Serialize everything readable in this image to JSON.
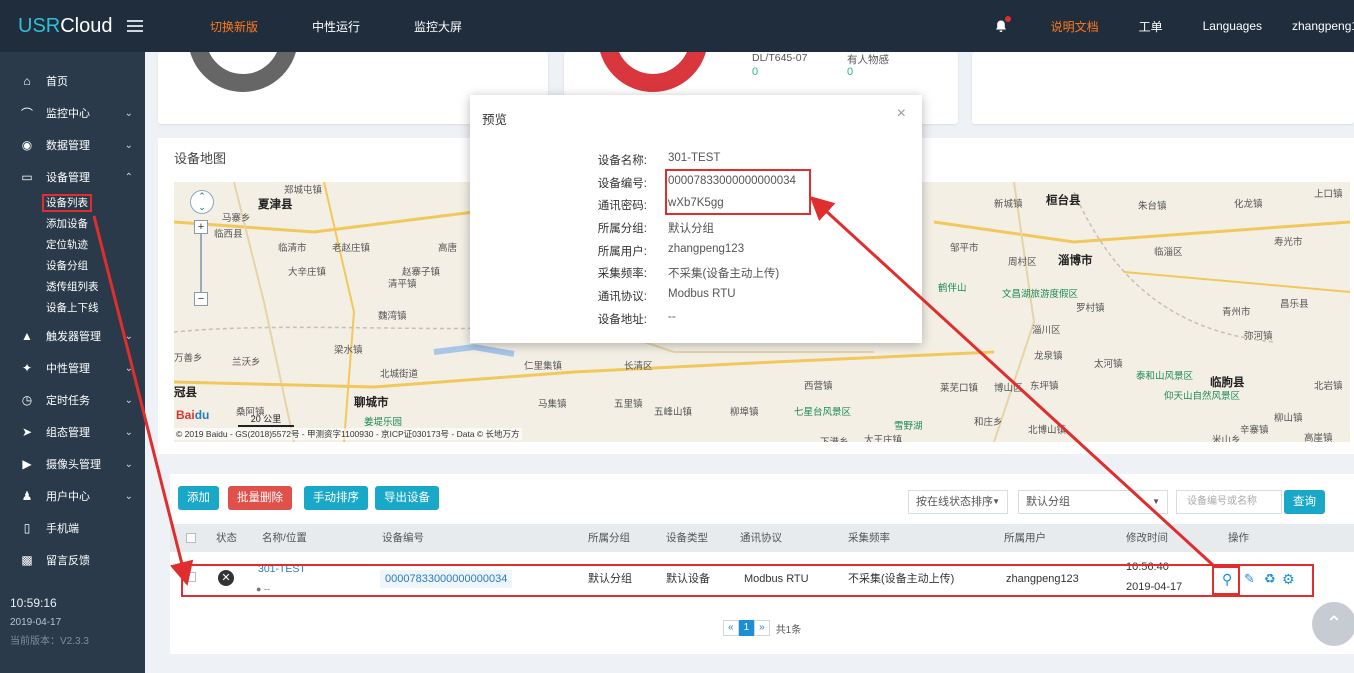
{
  "app": {
    "logo_usr": "USR",
    "logo_cloud": "Cloud"
  },
  "topnav": {
    "switch": "切换新版",
    "neutral": "中性运行",
    "bigscreen": "监控大屏"
  },
  "topright": {
    "docs": "说明文档",
    "ticket": "工单",
    "languages": "Languages",
    "user": "zhangpeng123"
  },
  "sidebar": {
    "items": [
      {
        "label": "首页",
        "icon": "home-icon"
      },
      {
        "label": "监控中心",
        "icon": "gauge-icon"
      },
      {
        "label": "数据管理",
        "icon": "target-icon"
      },
      {
        "label": "设备管理",
        "icon": "monitor-icon"
      }
    ],
    "sub_items": [
      "设备列表",
      "添加设备",
      "定位轨迹",
      "设备分组",
      "透传组列表",
      "设备上下线"
    ],
    "more_items": [
      {
        "label": "触发器管理",
        "icon": "bell-icon"
      },
      {
        "label": "中性管理",
        "icon": "tools-icon"
      },
      {
        "label": "定时任务",
        "icon": "clock-icon"
      },
      {
        "label": "组态管理",
        "icon": "send-icon"
      },
      {
        "label": "摄像头管理",
        "icon": "camera-icon"
      },
      {
        "label": "用户中心",
        "icon": "users-icon"
      },
      {
        "label": "手机端",
        "icon": "phone-icon"
      },
      {
        "label": "留言反馈",
        "icon": "comment-icon"
      }
    ],
    "time": "10:59:16",
    "date": "2019-04-17",
    "version": "当前版本：V2.3.3"
  },
  "cards": {
    "col1": "DL/T645-07",
    "col1_val": "0",
    "col2": "有人物感",
    "col2_val": "0"
  },
  "map": {
    "title": "设备地图",
    "scale": "20 公里",
    "copyright": "© 2019 Baidu - GS(2018)5572号 - 甲测资字1100930 - 京ICP证030173号 - Data © 长地万方",
    "labels": {
      "l1": "郑城屯镇",
      "l2": "夏津县",
      "l3": "马寨乡",
      "l4": "临西县",
      "l5": "临清市",
      "l6": "老赵庄镇",
      "l7": "高唐",
      "l8": "大辛庄镇",
      "l9": "清平镇",
      "l10": "赵寨子镇",
      "l11": "魏湾镇",
      "l12": "梁水镇",
      "l13": "北城街道",
      "l14": "万善乡",
      "l15": "兰沃乡",
      "l16": "冠县",
      "l17": "聊城市",
      "l18": "桑阿镇",
      "l19": "姜堤乐园",
      "l20": "长清区",
      "l21": "五峰山镇",
      "l22": "七星台风景区",
      "l23": "西营镇",
      "l24": "柳埠镇",
      "l25": "雪野湖",
      "l26": "新城镇",
      "l27": "桓台县",
      "l28": "邹平市",
      "l29": "周村区",
      "l30": "淄博市",
      "l31": "鹤伴山",
      "l32": "文昌湖旅游度假区",
      "l33": "罗村镇",
      "l34": "淄川区",
      "l35": "龙泉镇",
      "l36": "太河镇",
      "l37": "泰和山风景区",
      "l38": "东坪镇",
      "l39": "博山区",
      "l40": "临朐县",
      "l41": "仰天山自然风景区",
      "l42": "青州市",
      "l43": "临淄区",
      "l44": "朱台镇",
      "l45": "昌乐县",
      "l46": "上口镇",
      "l47": "寿光市",
      "l48": "化龙镇",
      "l49": "弥河镇",
      "l50": "柳山镇",
      "l51": "北岩镇",
      "l52": "高崖镇",
      "l53": "米山乡",
      "l54": "辛寨镇",
      "l55": "和庄乡",
      "l56": "北博山镇",
      "l57": "大王庄镇",
      "l58": "下港乡",
      "l59": "莱芜口镇",
      "l60": "仁里集镇",
      "l61": "五里镇",
      "l62": "马集镇"
    }
  },
  "modal": {
    "title": "预览",
    "fields": [
      {
        "k": "设备名称:",
        "v": "301-TEST"
      },
      {
        "k": "设备编号:",
        "v": "00007833000000000034"
      },
      {
        "k": "通讯密码:",
        "v": "wXb7K5gg"
      },
      {
        "k": "所属分组:",
        "v": "默认分组"
      },
      {
        "k": "所属用户:",
        "v": "zhangpeng123"
      },
      {
        "k": "采集频率:",
        "v": "不采集(设备主动上传)"
      },
      {
        "k": "通讯协议:",
        "v": "Modbus RTU"
      },
      {
        "k": "设备地址:",
        "v": "--"
      }
    ]
  },
  "toolbar": {
    "add": "添加",
    "batch_delete": "批量删除",
    "manual_sort": "手动排序",
    "export": "导出设备",
    "sort_select": "按在线状态排序",
    "group_select": "默认分组",
    "search_placeholder": "设备编号或名称",
    "search": "查询"
  },
  "table": {
    "headers": [
      "状态",
      "名称/位置",
      "设备编号",
      "所属分组",
      "设备类型",
      "通讯协议",
      "采集频率",
      "所属用户",
      "修改时间",
      "操作"
    ],
    "row": {
      "name": "301-TEST",
      "location": "--",
      "device_no": "00007833000000000034",
      "group": "默认分组",
      "type": "默认设备",
      "protocol": "Modbus RTU",
      "freq": "不采集(设备主动上传)",
      "user": "zhangpeng123",
      "time": "10:56:40",
      "date": "2019-04-17"
    }
  },
  "pager": {
    "prev": "«",
    "page": "1",
    "next": "»",
    "total": "共1条"
  }
}
